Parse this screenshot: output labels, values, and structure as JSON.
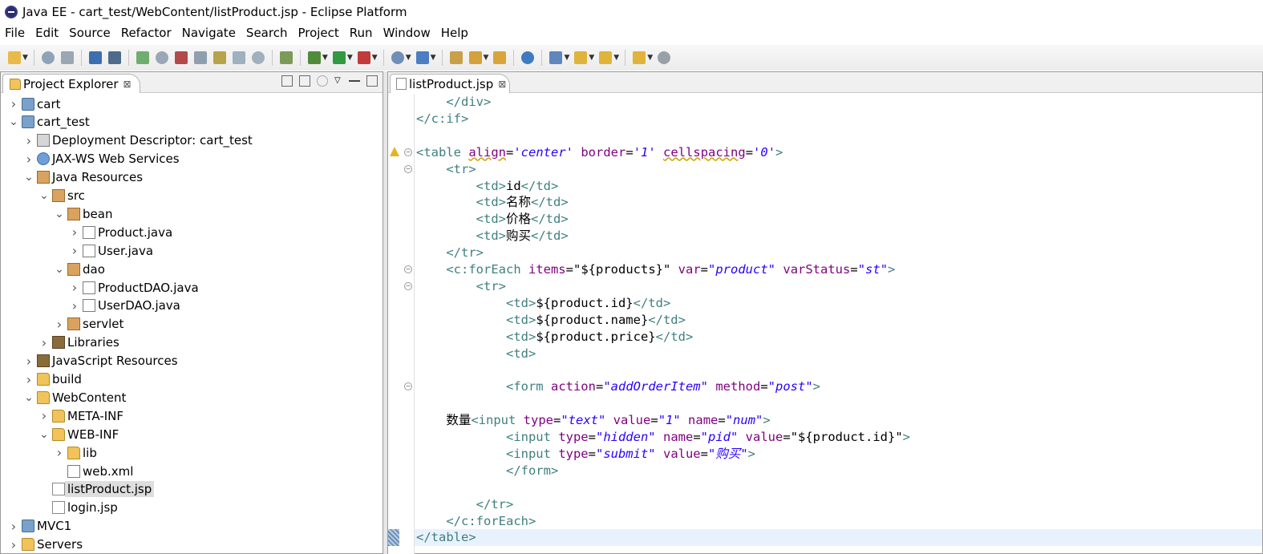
{
  "window": {
    "title": "Java EE - cart_test/WebContent/listProduct.jsp - Eclipse Platform"
  },
  "menu": [
    "File",
    "Edit",
    "Source",
    "Refactor",
    "Navigate",
    "Search",
    "Project",
    "Run",
    "Window",
    "Help"
  ],
  "project_explorer": {
    "tab_label": "Project Explorer",
    "tab_close": "⊠",
    "tree": [
      {
        "label": "cart",
        "depth": 0,
        "expanded": false,
        "icon": "project-icon"
      },
      {
        "label": "cart_test",
        "depth": 0,
        "expanded": true,
        "icon": "project-icon"
      },
      {
        "label": "Deployment Descriptor: cart_test",
        "depth": 1,
        "expanded": false,
        "icon": "descriptor-icon"
      },
      {
        "label": "JAX-WS Web Services",
        "depth": 1,
        "expanded": false,
        "icon": "webservice-icon"
      },
      {
        "label": "Java Resources",
        "depth": 1,
        "expanded": true,
        "icon": "java-resources-icon"
      },
      {
        "label": "src",
        "depth": 2,
        "expanded": true,
        "icon": "source-folder-icon"
      },
      {
        "label": "bean",
        "depth": 3,
        "expanded": true,
        "icon": "package-icon"
      },
      {
        "label": "Product.java",
        "depth": 4,
        "expanded": false,
        "icon": "java-file-icon"
      },
      {
        "label": "User.java",
        "depth": 4,
        "expanded": false,
        "icon": "java-file-icon"
      },
      {
        "label": "dao",
        "depth": 3,
        "expanded": true,
        "icon": "package-icon"
      },
      {
        "label": "ProductDAO.java",
        "depth": 4,
        "expanded": false,
        "icon": "java-file-icon"
      },
      {
        "label": "UserDAO.java",
        "depth": 4,
        "expanded": false,
        "icon": "java-file-icon"
      },
      {
        "label": "servlet",
        "depth": 3,
        "expanded": false,
        "icon": "package-icon"
      },
      {
        "label": "Libraries",
        "depth": 2,
        "expanded": false,
        "icon": "library-icon"
      },
      {
        "label": "JavaScript Resources",
        "depth": 1,
        "expanded": false,
        "icon": "library-icon"
      },
      {
        "label": "build",
        "depth": 1,
        "expanded": false,
        "icon": "folder-icon"
      },
      {
        "label": "WebContent",
        "depth": 1,
        "expanded": true,
        "icon": "folder-icon"
      },
      {
        "label": "META-INF",
        "depth": 2,
        "expanded": false,
        "icon": "folder-icon"
      },
      {
        "label": "WEB-INF",
        "depth": 2,
        "expanded": true,
        "icon": "folder-icon"
      },
      {
        "label": "lib",
        "depth": 3,
        "expanded": false,
        "icon": "folder-icon"
      },
      {
        "label": "web.xml",
        "depth": 3,
        "leaf": true,
        "icon": "xml-file-icon"
      },
      {
        "label": "listProduct.jsp",
        "depth": 2,
        "leaf": true,
        "selected": true,
        "icon": "jsp-file-icon"
      },
      {
        "label": "login.jsp",
        "depth": 2,
        "leaf": true,
        "icon": "jsp-file-icon"
      },
      {
        "label": "MVC1",
        "depth": 0,
        "expanded": false,
        "icon": "project-icon"
      },
      {
        "label": "Servers",
        "depth": 0,
        "expanded": false,
        "icon": "folder-icon"
      }
    ]
  },
  "editor": {
    "tab_label": "listProduct.jsp",
    "tab_close": "⊠",
    "lines": [
      {
        "fold": false,
        "warn": false,
        "tokens": [
          {
            "t": "    "
          },
          {
            "t": "</div>",
            "c": "tag"
          }
        ]
      },
      {
        "fold": false,
        "warn": false,
        "tokens": [
          {
            "t": "</c:if>",
            "c": "tag"
          }
        ]
      },
      {
        "fold": false,
        "warn": false,
        "tokens": []
      },
      {
        "fold": true,
        "warn": true,
        "tokens": [
          {
            "t": "<table ",
            "c": "tag"
          },
          {
            "t": "align",
            "c": "attr",
            "squig": true
          },
          {
            "t": "=",
            "c": "txt"
          },
          {
            "t": "'center'",
            "c": "val"
          },
          {
            "t": " ",
            "c": "txt"
          },
          {
            "t": "border",
            "c": "attr"
          },
          {
            "t": "=",
            "c": "txt"
          },
          {
            "t": "'1'",
            "c": "val"
          },
          {
            "t": " ",
            "c": "txt"
          },
          {
            "t": "cellspacing",
            "c": "attr",
            "squig": true
          },
          {
            "t": "=",
            "c": "txt"
          },
          {
            "t": "'0'",
            "c": "val"
          },
          {
            "t": ">",
            "c": "tag"
          }
        ]
      },
      {
        "fold": true,
        "warn": false,
        "tokens": [
          {
            "t": "    "
          },
          {
            "t": "<tr>",
            "c": "tag"
          }
        ]
      },
      {
        "fold": false,
        "warn": false,
        "tokens": [
          {
            "t": "        "
          },
          {
            "t": "<td>",
            "c": "tag"
          },
          {
            "t": "id",
            "c": "txt"
          },
          {
            "t": "</td>",
            "c": "tag"
          }
        ]
      },
      {
        "fold": false,
        "warn": false,
        "tokens": [
          {
            "t": "        "
          },
          {
            "t": "<td>",
            "c": "tag"
          },
          {
            "t": "名称",
            "c": "txt"
          },
          {
            "t": "</td>",
            "c": "tag"
          }
        ]
      },
      {
        "fold": false,
        "warn": false,
        "tokens": [
          {
            "t": "        "
          },
          {
            "t": "<td>",
            "c": "tag"
          },
          {
            "t": "价格",
            "c": "txt"
          },
          {
            "t": "</td>",
            "c": "tag"
          }
        ]
      },
      {
        "fold": false,
        "warn": false,
        "tokens": [
          {
            "t": "        "
          },
          {
            "t": "<td>",
            "c": "tag"
          },
          {
            "t": "购买",
            "c": "txt"
          },
          {
            "t": "</td>",
            "c": "tag"
          }
        ]
      },
      {
        "fold": false,
        "warn": false,
        "tokens": [
          {
            "t": "    "
          },
          {
            "t": "</tr>",
            "c": "tag"
          }
        ]
      },
      {
        "fold": true,
        "warn": false,
        "tokens": [
          {
            "t": "    "
          },
          {
            "t": "<c:forEach ",
            "c": "tag"
          },
          {
            "t": "items",
            "c": "attr"
          },
          {
            "t": "=",
            "c": "txt"
          },
          {
            "t": "\"${products}\"",
            "c": "txt"
          },
          {
            "t": " ",
            "c": "txt"
          },
          {
            "t": "var",
            "c": "attr"
          },
          {
            "t": "=",
            "c": "txt"
          },
          {
            "t": "\"product\"",
            "c": "val"
          },
          {
            "t": " ",
            "c": "txt"
          },
          {
            "t": "varStatus",
            "c": "attr"
          },
          {
            "t": "=",
            "c": "txt"
          },
          {
            "t": "\"st\"",
            "c": "val"
          },
          {
            "t": ">",
            "c": "tag"
          }
        ]
      },
      {
        "fold": true,
        "warn": false,
        "tokens": [
          {
            "t": "        "
          },
          {
            "t": "<tr>",
            "c": "tag"
          }
        ]
      },
      {
        "fold": false,
        "warn": false,
        "tokens": [
          {
            "t": "            "
          },
          {
            "t": "<td>",
            "c": "tag"
          },
          {
            "t": "${product.id}",
            "c": "txt"
          },
          {
            "t": "</td>",
            "c": "tag"
          }
        ]
      },
      {
        "fold": false,
        "warn": false,
        "tokens": [
          {
            "t": "            "
          },
          {
            "t": "<td>",
            "c": "tag"
          },
          {
            "t": "${product.name}",
            "c": "txt"
          },
          {
            "t": "</td>",
            "c": "tag"
          }
        ]
      },
      {
        "fold": false,
        "warn": false,
        "tokens": [
          {
            "t": "            "
          },
          {
            "t": "<td>",
            "c": "tag"
          },
          {
            "t": "${product.price}",
            "c": "txt"
          },
          {
            "t": "</td>",
            "c": "tag"
          }
        ]
      },
      {
        "fold": false,
        "warn": false,
        "tokens": [
          {
            "t": "            "
          },
          {
            "t": "<td>",
            "c": "tag"
          }
        ]
      },
      {
        "fold": false,
        "warn": false,
        "tokens": []
      },
      {
        "fold": true,
        "warn": false,
        "tokens": [
          {
            "t": "            "
          },
          {
            "t": "<form ",
            "c": "tag"
          },
          {
            "t": "action",
            "c": "attr"
          },
          {
            "t": "=",
            "c": "txt"
          },
          {
            "t": "\"addOrderItem\"",
            "c": "val"
          },
          {
            "t": " ",
            "c": "txt"
          },
          {
            "t": "method",
            "c": "attr"
          },
          {
            "t": "=",
            "c": "txt"
          },
          {
            "t": "\"post\"",
            "c": "val"
          },
          {
            "t": ">",
            "c": "tag"
          }
        ]
      },
      {
        "fold": false,
        "warn": false,
        "tokens": []
      },
      {
        "fold": false,
        "warn": false,
        "tokens": [
          {
            "t": "    数量",
            "c": "txt"
          },
          {
            "t": "<input ",
            "c": "tag"
          },
          {
            "t": "type",
            "c": "attr"
          },
          {
            "t": "=",
            "c": "txt"
          },
          {
            "t": "\"text\"",
            "c": "val"
          },
          {
            "t": " ",
            "c": "txt"
          },
          {
            "t": "value",
            "c": "attr"
          },
          {
            "t": "=",
            "c": "txt"
          },
          {
            "t": "\"1\"",
            "c": "val"
          },
          {
            "t": " ",
            "c": "txt"
          },
          {
            "t": "name",
            "c": "attr"
          },
          {
            "t": "=",
            "c": "txt"
          },
          {
            "t": "\"num\"",
            "c": "val"
          },
          {
            "t": ">",
            "c": "tag"
          }
        ]
      },
      {
        "fold": false,
        "warn": false,
        "tokens": [
          {
            "t": "            "
          },
          {
            "t": "<input ",
            "c": "tag"
          },
          {
            "t": "type",
            "c": "attr"
          },
          {
            "t": "=",
            "c": "txt"
          },
          {
            "t": "\"hidden\"",
            "c": "val"
          },
          {
            "t": " ",
            "c": "txt"
          },
          {
            "t": "name",
            "c": "attr"
          },
          {
            "t": "=",
            "c": "txt"
          },
          {
            "t": "\"pid\"",
            "c": "val"
          },
          {
            "t": " ",
            "c": "txt"
          },
          {
            "t": "value",
            "c": "attr"
          },
          {
            "t": "=",
            "c": "txt"
          },
          {
            "t": "\"${product.id}\"",
            "c": "txt"
          },
          {
            "t": ">",
            "c": "tag"
          }
        ]
      },
      {
        "fold": false,
        "warn": false,
        "tokens": [
          {
            "t": "            "
          },
          {
            "t": "<input ",
            "c": "tag"
          },
          {
            "t": "type",
            "c": "attr"
          },
          {
            "t": "=",
            "c": "txt"
          },
          {
            "t": "\"submit\"",
            "c": "val"
          },
          {
            "t": " ",
            "c": "txt"
          },
          {
            "t": "value",
            "c": "attr"
          },
          {
            "t": "=",
            "c": "txt"
          },
          {
            "t": "\"购买\"",
            "c": "val"
          },
          {
            "t": ">",
            "c": "tag"
          }
        ]
      },
      {
        "fold": false,
        "warn": false,
        "tokens": [
          {
            "t": "            "
          },
          {
            "t": "</form>",
            "c": "tag"
          }
        ]
      },
      {
        "fold": false,
        "warn": false,
        "tokens": []
      },
      {
        "fold": false,
        "warn": false,
        "tokens": [
          {
            "t": "        "
          },
          {
            "t": "</tr>",
            "c": "tag"
          }
        ]
      },
      {
        "fold": false,
        "warn": false,
        "tokens": [
          {
            "t": "    "
          },
          {
            "t": "</c:forEach>",
            "c": "tag"
          }
        ]
      },
      {
        "fold": false,
        "warn": false,
        "current": true,
        "bookmark": true,
        "tokens": [
          {
            "t": "</table>",
            "c": "tag"
          }
        ]
      }
    ]
  },
  "colors": {
    "tag": "#3f7f7f",
    "attribute": "#7f007f",
    "attribute_value": "#2a00ff",
    "current_line": "#e8f2fe",
    "selection": "#dedede"
  },
  "toolbar_icons": [
    "new-icon",
    "save-icon",
    "save-all-icon",
    "console-icon",
    "skip-breakpoints-icon",
    "resume-icon",
    "suspend-icon",
    "terminate-icon",
    "disconnect-icon",
    "step-into-icon",
    "step-over-icon",
    "step-return-icon",
    "external-tools-icon",
    "debug-icon",
    "run-icon",
    "coverage-icon",
    "new-server-icon",
    "new-class-icon",
    "open-type-icon",
    "open-task-icon",
    "search-icon",
    "globe-icon",
    "annotation-icon",
    "next-annotation-icon",
    "prev-annotation-icon",
    "back-icon",
    "forward-icon"
  ]
}
